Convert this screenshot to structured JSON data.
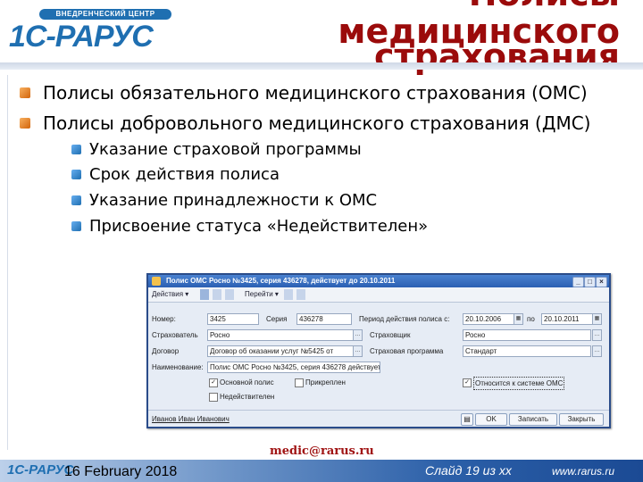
{
  "header": {
    "logo_badge": "ВНЕДРЕНЧЕСКИЙ ЦЕНТР",
    "logo_brand": "1С-РАРУС",
    "title_line1": "Полисы",
    "title_line2": "медицинского",
    "title_line3": "страхования",
    "colors": {
      "title": "#9b0b0b",
      "brand": "#1f6fb1"
    }
  },
  "bullets": [
    {
      "text": "Полисы обязательного медицинского страхования (ОМС)"
    },
    {
      "text": "Полисы добровольного медицинского страхования (ДМС)",
      "children": [
        "Указание страховой программы",
        "Срок действия полиса",
        "Указание принадлежности к ОМС",
        "Присвоение статуса «Недействителен»"
      ]
    }
  ],
  "window": {
    "title": "Полис ОМС Росно №3425, серия 436278, действует до 20.10.2011",
    "toolbar": {
      "actions": "Действия",
      "goto": "Перейти"
    },
    "fields": {
      "number_label": "Номер:",
      "number_value": "3425",
      "series_label": "Серия",
      "series_value": "436278",
      "period_label": "Период действия полиса с:",
      "period_from": "20.10.2006",
      "period_to_label": "по",
      "period_to": "20.10.2011",
      "insurer_label": "Страховщик",
      "insurer_value": "Росно",
      "policyholder_label": "Страхователь",
      "policyholder_value": "Росно",
      "contract_label": "Договор",
      "contract_value": "Договор об оказании услуг №5425 от",
      "program_label": "Страховая программа",
      "program_value": "Стандарт",
      "name_label": "Наименование:",
      "name_value": "Полис ОМС Росно №3425, серия 436278 действует до 20.10.201"
    },
    "checkboxes": {
      "main_policy": {
        "label": "Основной полис",
        "checked": true
      },
      "attached": {
        "label": "Прикреплен",
        "checked": false
      },
      "not_valid": {
        "label": "Недействителен",
        "checked": false
      },
      "oms_belongs": {
        "label": "Относится к системе ОМС",
        "checked": true
      }
    },
    "bottom": {
      "user": "Иванов Иван Иванович",
      "ok": "OK",
      "save": "Записать",
      "close": "Закрыть"
    }
  },
  "footer": {
    "email": "medic@rarus.ru",
    "logo": "1С-РАРУС",
    "date": "16 February 2018",
    "slide": "Слайд 19 из xx",
    "url": "www.rarus.ru"
  }
}
